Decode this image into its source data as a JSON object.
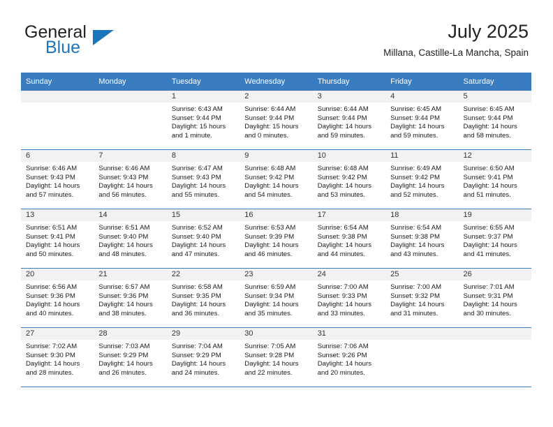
{
  "brand": {
    "name_top": "General",
    "name_bottom": "Blue",
    "accent_color": "#1b75bb"
  },
  "header": {
    "title": "July 2025",
    "subtitle": "Millana, Castille-La Mancha, Spain"
  },
  "calendar": {
    "header_color": "#3a7cc0",
    "daynum_bg": "#f2f2f2",
    "weekday_headers": [
      "Sunday",
      "Monday",
      "Tuesday",
      "Wednesday",
      "Thursday",
      "Friday",
      "Saturday"
    ],
    "weeks": [
      [
        {
          "day": ""
        },
        {
          "day": ""
        },
        {
          "day": "1",
          "sunrise": "Sunrise: 6:43 AM",
          "sunset": "Sunset: 9:44 PM",
          "daylight_1": "Daylight: 15 hours",
          "daylight_2": "and 1 minute."
        },
        {
          "day": "2",
          "sunrise": "Sunrise: 6:44 AM",
          "sunset": "Sunset: 9:44 PM",
          "daylight_1": "Daylight: 15 hours",
          "daylight_2": "and 0 minutes."
        },
        {
          "day": "3",
          "sunrise": "Sunrise: 6:44 AM",
          "sunset": "Sunset: 9:44 PM",
          "daylight_1": "Daylight: 14 hours",
          "daylight_2": "and 59 minutes."
        },
        {
          "day": "4",
          "sunrise": "Sunrise: 6:45 AM",
          "sunset": "Sunset: 9:44 PM",
          "daylight_1": "Daylight: 14 hours",
          "daylight_2": "and 59 minutes."
        },
        {
          "day": "5",
          "sunrise": "Sunrise: 6:45 AM",
          "sunset": "Sunset: 9:44 PM",
          "daylight_1": "Daylight: 14 hours",
          "daylight_2": "and 58 minutes."
        }
      ],
      [
        {
          "day": "6",
          "sunrise": "Sunrise: 6:46 AM",
          "sunset": "Sunset: 9:43 PM",
          "daylight_1": "Daylight: 14 hours",
          "daylight_2": "and 57 minutes."
        },
        {
          "day": "7",
          "sunrise": "Sunrise: 6:46 AM",
          "sunset": "Sunset: 9:43 PM",
          "daylight_1": "Daylight: 14 hours",
          "daylight_2": "and 56 minutes."
        },
        {
          "day": "8",
          "sunrise": "Sunrise: 6:47 AM",
          "sunset": "Sunset: 9:43 PM",
          "daylight_1": "Daylight: 14 hours",
          "daylight_2": "and 55 minutes."
        },
        {
          "day": "9",
          "sunrise": "Sunrise: 6:48 AM",
          "sunset": "Sunset: 9:42 PM",
          "daylight_1": "Daylight: 14 hours",
          "daylight_2": "and 54 minutes."
        },
        {
          "day": "10",
          "sunrise": "Sunrise: 6:48 AM",
          "sunset": "Sunset: 9:42 PM",
          "daylight_1": "Daylight: 14 hours",
          "daylight_2": "and 53 minutes."
        },
        {
          "day": "11",
          "sunrise": "Sunrise: 6:49 AM",
          "sunset": "Sunset: 9:42 PM",
          "daylight_1": "Daylight: 14 hours",
          "daylight_2": "and 52 minutes."
        },
        {
          "day": "12",
          "sunrise": "Sunrise: 6:50 AM",
          "sunset": "Sunset: 9:41 PM",
          "daylight_1": "Daylight: 14 hours",
          "daylight_2": "and 51 minutes."
        }
      ],
      [
        {
          "day": "13",
          "sunrise": "Sunrise: 6:51 AM",
          "sunset": "Sunset: 9:41 PM",
          "daylight_1": "Daylight: 14 hours",
          "daylight_2": "and 50 minutes."
        },
        {
          "day": "14",
          "sunrise": "Sunrise: 6:51 AM",
          "sunset": "Sunset: 9:40 PM",
          "daylight_1": "Daylight: 14 hours",
          "daylight_2": "and 48 minutes."
        },
        {
          "day": "15",
          "sunrise": "Sunrise: 6:52 AM",
          "sunset": "Sunset: 9:40 PM",
          "daylight_1": "Daylight: 14 hours",
          "daylight_2": "and 47 minutes."
        },
        {
          "day": "16",
          "sunrise": "Sunrise: 6:53 AM",
          "sunset": "Sunset: 9:39 PM",
          "daylight_1": "Daylight: 14 hours",
          "daylight_2": "and 46 minutes."
        },
        {
          "day": "17",
          "sunrise": "Sunrise: 6:54 AM",
          "sunset": "Sunset: 9:38 PM",
          "daylight_1": "Daylight: 14 hours",
          "daylight_2": "and 44 minutes."
        },
        {
          "day": "18",
          "sunrise": "Sunrise: 6:54 AM",
          "sunset": "Sunset: 9:38 PM",
          "daylight_1": "Daylight: 14 hours",
          "daylight_2": "and 43 minutes."
        },
        {
          "day": "19",
          "sunrise": "Sunrise: 6:55 AM",
          "sunset": "Sunset: 9:37 PM",
          "daylight_1": "Daylight: 14 hours",
          "daylight_2": "and 41 minutes."
        }
      ],
      [
        {
          "day": "20",
          "sunrise": "Sunrise: 6:56 AM",
          "sunset": "Sunset: 9:36 PM",
          "daylight_1": "Daylight: 14 hours",
          "daylight_2": "and 40 minutes."
        },
        {
          "day": "21",
          "sunrise": "Sunrise: 6:57 AM",
          "sunset": "Sunset: 9:36 PM",
          "daylight_1": "Daylight: 14 hours",
          "daylight_2": "and 38 minutes."
        },
        {
          "day": "22",
          "sunrise": "Sunrise: 6:58 AM",
          "sunset": "Sunset: 9:35 PM",
          "daylight_1": "Daylight: 14 hours",
          "daylight_2": "and 36 minutes."
        },
        {
          "day": "23",
          "sunrise": "Sunrise: 6:59 AM",
          "sunset": "Sunset: 9:34 PM",
          "daylight_1": "Daylight: 14 hours",
          "daylight_2": "and 35 minutes."
        },
        {
          "day": "24",
          "sunrise": "Sunrise: 7:00 AM",
          "sunset": "Sunset: 9:33 PM",
          "daylight_1": "Daylight: 14 hours",
          "daylight_2": "and 33 minutes."
        },
        {
          "day": "25",
          "sunrise": "Sunrise: 7:00 AM",
          "sunset": "Sunset: 9:32 PM",
          "daylight_1": "Daylight: 14 hours",
          "daylight_2": "and 31 minutes."
        },
        {
          "day": "26",
          "sunrise": "Sunrise: 7:01 AM",
          "sunset": "Sunset: 9:31 PM",
          "daylight_1": "Daylight: 14 hours",
          "daylight_2": "and 30 minutes."
        }
      ],
      [
        {
          "day": "27",
          "sunrise": "Sunrise: 7:02 AM",
          "sunset": "Sunset: 9:30 PM",
          "daylight_1": "Daylight: 14 hours",
          "daylight_2": "and 28 minutes."
        },
        {
          "day": "28",
          "sunrise": "Sunrise: 7:03 AM",
          "sunset": "Sunset: 9:29 PM",
          "daylight_1": "Daylight: 14 hours",
          "daylight_2": "and 26 minutes."
        },
        {
          "day": "29",
          "sunrise": "Sunrise: 7:04 AM",
          "sunset": "Sunset: 9:29 PM",
          "daylight_1": "Daylight: 14 hours",
          "daylight_2": "and 24 minutes."
        },
        {
          "day": "30",
          "sunrise": "Sunrise: 7:05 AM",
          "sunset": "Sunset: 9:28 PM",
          "daylight_1": "Daylight: 14 hours",
          "daylight_2": "and 22 minutes."
        },
        {
          "day": "31",
          "sunrise": "Sunrise: 7:06 AM",
          "sunset": "Sunset: 9:26 PM",
          "daylight_1": "Daylight: 14 hours",
          "daylight_2": "and 20 minutes."
        },
        {
          "day": ""
        },
        {
          "day": ""
        }
      ]
    ]
  }
}
